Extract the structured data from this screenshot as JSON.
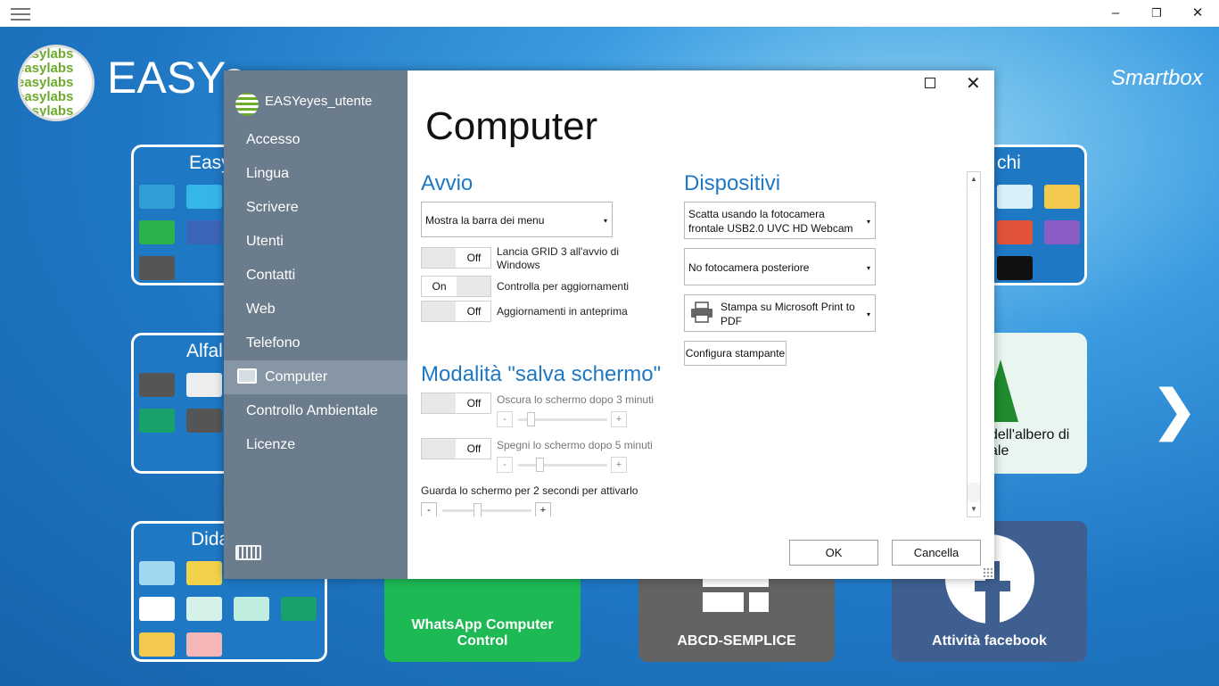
{
  "window": {
    "minimize": "–",
    "maximize": "❐",
    "close": "✕"
  },
  "background": {
    "logo_lines": [
      "easylabs",
      "easylabs",
      "easylabs",
      "easylabs"
    ],
    "app_title": "EASYe",
    "brand": "Smartbox",
    "next_arrow": "❯",
    "tiles": {
      "easy_title": "Easy",
      "alfa_title": "Alfal",
      "dida_title": "Dida",
      "giochi_title": "chi",
      "albero_text": "dell'albero di\nale",
      "whatsapp_label": "WhatsApp Computer Control",
      "abcd_label": "ABCD-SEMPLICE",
      "facebook_label": "Attività facebook"
    }
  },
  "dialog": {
    "heading": "Computer",
    "sidebar": {
      "user": "EASYeyes_utente",
      "items": [
        "Accesso",
        "Lingua",
        "Scrivere",
        "Utenti",
        "Contatti",
        "Web",
        "Telefono",
        "Computer",
        "Controllo Ambientale",
        "Licenze"
      ],
      "active": "Computer"
    },
    "avvio": {
      "title": "Avvio",
      "dropdown": "Mostra la barra dei menu",
      "launch_toggle": {
        "state": "Off",
        "label": "Lancia GRID 3 all'avvio di Windows"
      },
      "updates_toggle": {
        "state": "On",
        "label": "Controlla per aggiornamenti"
      },
      "preview_toggle": {
        "state": "Off",
        "label": "Aggiornamenti in anteprima"
      }
    },
    "screensaver": {
      "title": "Modalità \"salva schermo\"",
      "dim_toggle": {
        "state": "Off",
        "label": "Oscura lo schermo dopo 3 minuti"
      },
      "off_toggle": {
        "state": "Off",
        "label": "Spegni lo schermo dopo 5 minuti"
      },
      "look_label": "Guarda lo schermo per 2 secondi per attivarlo",
      "minus": "-",
      "plus": "+"
    },
    "dispositivi": {
      "title": "Dispositivi",
      "front_camera": "Scatta usando la fotocamera frontale USB2.0 UVC HD Webcam",
      "rear_camera": "No fotocamera posteriore",
      "printer": "Stampa su Microsoft Print to PDF",
      "configure_button": "Configura stampante"
    },
    "ok_button": "OK",
    "cancel_button": "Cancella",
    "dropdown_arrow": "▾",
    "scroll_up": "▲",
    "scroll_down": "▼"
  }
}
